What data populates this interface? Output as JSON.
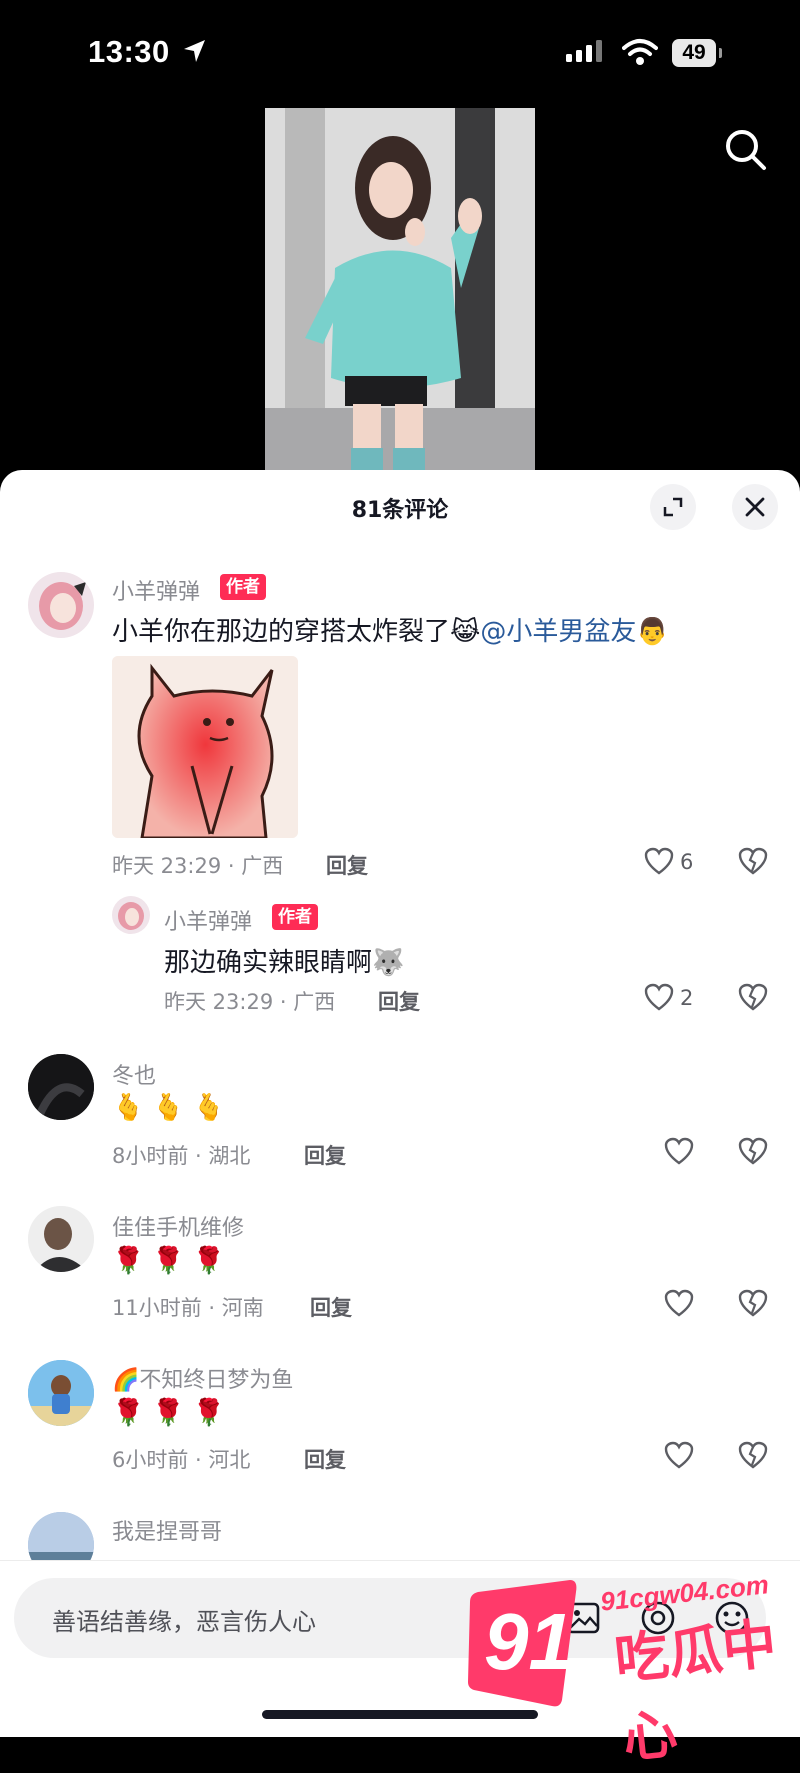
{
  "status_bar": {
    "time": "13:30",
    "battery": "49"
  },
  "sheet": {
    "title": "81条评论"
  },
  "comments": [
    {
      "user": "小羊弹弹",
      "badge": "作者",
      "text": "小羊你在那边的穿搭太炸裂了",
      "mention": "@小羊男盆友",
      "meta": "昨天 23:29 · 广西",
      "reply_label": "回复",
      "likes": "6"
    },
    {
      "user": "小羊弹弹",
      "badge": "作者",
      "text": "那边确实辣眼睛啊",
      "meta": "昨天 23:29 · 广西",
      "reply_label": "回复",
      "likes": "2"
    },
    {
      "user": "冬也",
      "emojis": "🫰🫰🫰",
      "meta": "8小时前 · 湖北",
      "reply_label": "回复"
    },
    {
      "user": "佳佳手机维修",
      "emojis": "🌹🌹🌹",
      "meta": "11小时前 · 河南",
      "reply_label": "回复"
    },
    {
      "user": "不知终日梦为鱼",
      "user_prefix": "🌈",
      "emojis": "🌹🌹🌹",
      "meta": "6小时前 · 河北",
      "reply_label": "回复"
    },
    {
      "user": "我是捏哥哥"
    }
  ],
  "input": {
    "placeholder": "善语结善缘，恶言伤人心"
  },
  "watermark": {
    "number": "91",
    "domain": "91cgw04.com",
    "name": "吃瓜中心"
  },
  "colors": {
    "accent": "#fe2c55",
    "mention": "#2a5a9a"
  }
}
